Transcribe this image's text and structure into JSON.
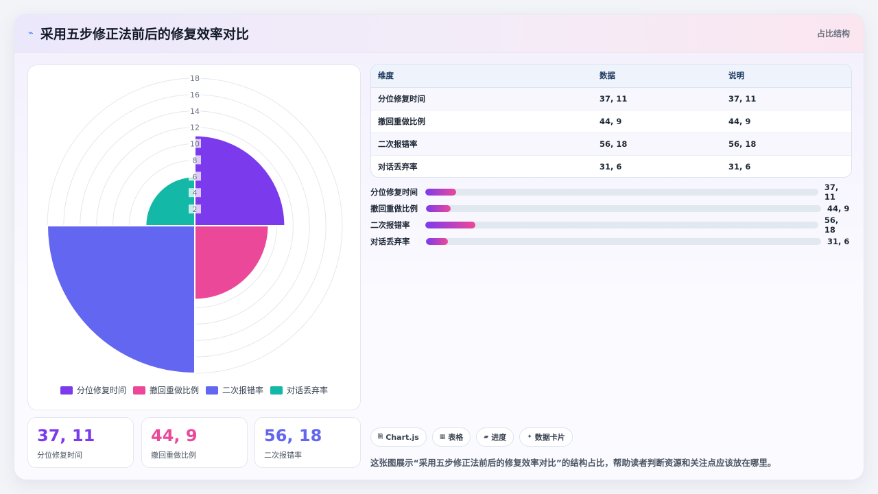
{
  "header": {
    "title": "采用五步修正法前后的修复效率对比",
    "tag": "占比结构",
    "logo_icon": "chart-line-icon"
  },
  "chart_data": {
    "type": "polar-area",
    "categories": [
      "分位修复时间",
      "撤回重做比例",
      "二次报错率",
      "对话丢弃率"
    ],
    "values": [
      11,
      9,
      18,
      6
    ],
    "colors": [
      "#7c3aed",
      "#ec4899",
      "#6366f1",
      "#14b8a6"
    ],
    "radial_ticks": [
      "",
      "2",
      "4",
      "6",
      "8",
      "10",
      "12",
      "14",
      "16",
      "18"
    ],
    "rmax": 18,
    "legend_position": "bottom"
  },
  "kpis": [
    {
      "value": "37, 11",
      "label": "分位修复时间",
      "color": "#7c3aed"
    },
    {
      "value": "44, 9",
      "label": "撤回重做比例",
      "color": "#ec4899"
    },
    {
      "value": "56, 18",
      "label": "二次报错率",
      "color": "#6366f1"
    }
  ],
  "table": {
    "headers": [
      "维度",
      "数据",
      "说明"
    ],
    "rows": [
      [
        "分位修复时间",
        "37, 11",
        "37, 11"
      ],
      [
        "撤回重做比例",
        "44, 9",
        "44, 9"
      ],
      [
        "二次报错率",
        "56, 18",
        "56, 18"
      ],
      [
        "对话丢弃率",
        "31, 6",
        "31, 6"
      ]
    ]
  },
  "progress": [
    {
      "label": "分位修复时间",
      "value": "37, 11",
      "fraction": 0.077
    },
    {
      "label": "撤回重做比例",
      "value": "44, 9",
      "fraction": 0.063
    },
    {
      "label": "二次报错率",
      "value": "56, 18",
      "fraction": 0.126
    },
    {
      "label": "对话丢弃率",
      "value": "31, 6",
      "fraction": 0.056
    }
  ],
  "chips": [
    {
      "icon": "file-icon",
      "glyph": "🖹",
      "label": "Chart.js"
    },
    {
      "icon": "table-icon",
      "glyph": "▦",
      "label": "表格"
    },
    {
      "icon": "progress-icon",
      "glyph": "▰",
      "label": "进度"
    },
    {
      "icon": "sparkle-icon",
      "glyph": "✦",
      "label": "数据卡片"
    }
  ],
  "description": "这张图展示“采用五步修正法前后的修复效率对比”的结构占比，帮助读者判断资源和关注点应该放在哪里。"
}
